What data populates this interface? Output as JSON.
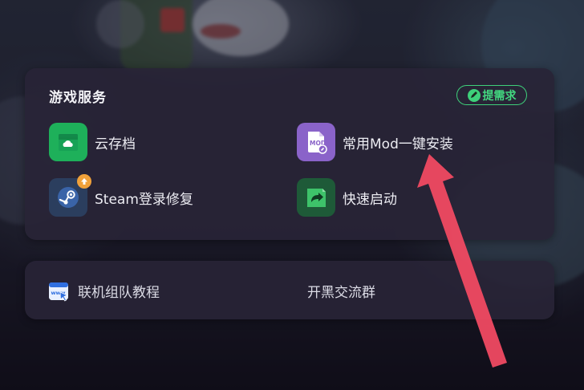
{
  "services": {
    "title": "游戏服务",
    "request_label": "提需求",
    "items": [
      {
        "label": "云存档",
        "icon": "cloud-save-icon"
      },
      {
        "label": "常用Mod一键安装",
        "icon": "mod-install-icon"
      },
      {
        "label": "Steam登录修复",
        "icon": "steam-icon"
      },
      {
        "label": "快速启动",
        "icon": "quick-start-icon"
      }
    ]
  },
  "links": {
    "guide_label": "联机组队教程",
    "guide_icon": "www-icon",
    "group_label": "开黑交流群"
  },
  "colors": {
    "accent_green": "#3ed07a",
    "cloud_icon_bg": "#1eb05a",
    "mod_icon_bg": "#8a63c9",
    "steam_icon_bg": "#2b3e5e",
    "start_icon_bg": "#1e5a38",
    "annotation_arrow": "#f04a62"
  }
}
